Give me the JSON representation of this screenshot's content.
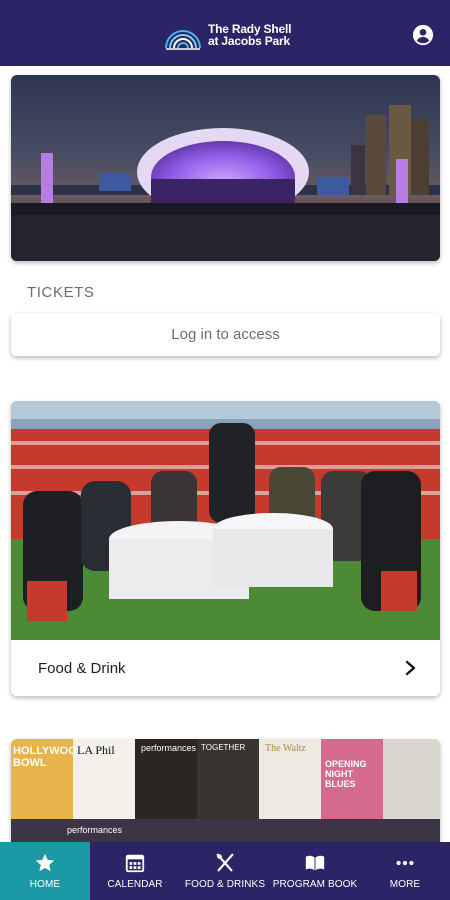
{
  "header": {
    "logo_line1": "The Rady Shell",
    "logo_line2": "at Jacobs Park",
    "profile_icon": "account-circle-icon"
  },
  "tickets": {
    "section_label": "TICKETS",
    "login_label": "Log in to access"
  },
  "food_card": {
    "label": "Food & Drink",
    "arrow_icon": "chevron-right-icon"
  },
  "program_covers": [
    "HOLLYWOOD BOWL",
    "LA Phil",
    "performances",
    "TOGETHER",
    "The Waltz",
    "OPENING NIGHT BLUES",
    "performances"
  ],
  "bottom_nav": {
    "items": [
      {
        "label": "HOME",
        "icon": "star-icon",
        "active": true
      },
      {
        "label": "CALENDAR",
        "icon": "calendar-icon"
      },
      {
        "label": "FOOD & DRINKS",
        "icon": "utensils-icon"
      },
      {
        "label": "PROGRAM BOOK",
        "icon": "book-icon"
      },
      {
        "label": "MORE",
        "icon": "more-dots-icon"
      }
    ]
  },
  "colors": {
    "brand": "#2b2466",
    "active_tab": "#1b9aa5"
  }
}
